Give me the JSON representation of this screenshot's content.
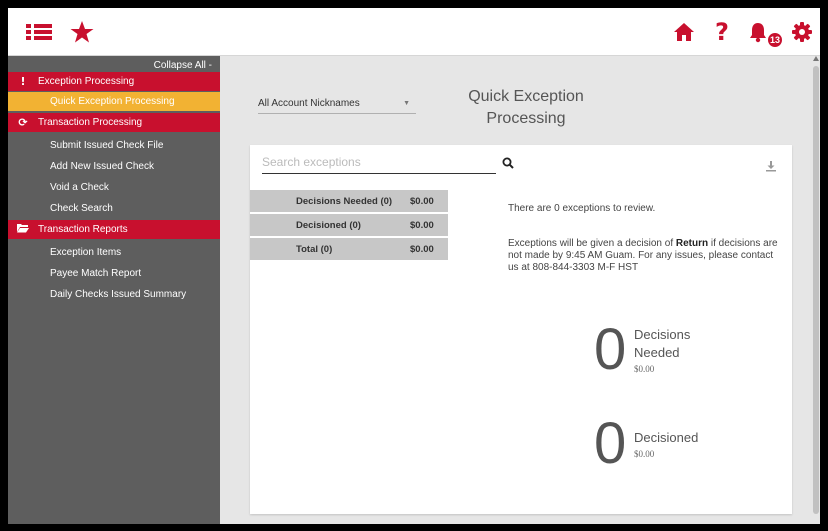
{
  "header": {
    "menu_icon": "list-icon",
    "favorite_icon": "star-icon",
    "home_icon": "home-icon",
    "help_icon": "question-icon",
    "help_glyph": "?",
    "notifications_icon": "bell-icon",
    "notifications_count": "13",
    "settings_icon": "gear-icon",
    "accent_color": "#c8102e"
  },
  "sidebar": {
    "collapse_all": "Collapse All -",
    "sections": [
      {
        "label": "Exception Processing",
        "icon": "exclamation-icon",
        "glyph": "!",
        "items": [
          {
            "label": "Quick Exception Processing",
            "active": true
          }
        ]
      },
      {
        "label": "Transaction Processing",
        "icon": "refresh-icon",
        "glyph": "⟳",
        "items": [
          {
            "label": "Submit Issued Check File"
          },
          {
            "label": "Add New Issued Check"
          },
          {
            "label": "Void a Check"
          },
          {
            "label": "Check Search"
          }
        ]
      },
      {
        "label": "Transaction Reports",
        "icon": "folder-open-icon",
        "glyph": "▬",
        "items": [
          {
            "label": "Exception Items"
          },
          {
            "label": "Payee Match Report"
          },
          {
            "label": "Daily Checks Issued Summary"
          }
        ]
      }
    ],
    "active_color": "#f2b233"
  },
  "main": {
    "account_select": "All Account Nicknames",
    "title": "Quick Exception Processing",
    "search": {
      "placeholder": "Search exceptions",
      "value": ""
    },
    "stats": [
      {
        "label": "Decisions Needed (0)",
        "value": "$0.00"
      },
      {
        "label": "Decisioned (0)",
        "value": "$0.00"
      },
      {
        "label": "Total (0)",
        "value": "$0.00"
      }
    ],
    "message_count": "There are 0 exceptions to review.",
    "message_rule_before": "Exceptions will be given a decision of ",
    "message_rule_bold": "Return",
    "message_rule_after": " if decisions are not made by 9:45 AM Guam. For any issues, please contact us at 808-844-3303 M-F HST",
    "summary": [
      {
        "count": "0",
        "label_line1": "Decisions",
        "label_line2": "Needed",
        "amount": "$0.00"
      },
      {
        "count": "0",
        "label_line1": "Decisioned",
        "label_line2": "",
        "amount": "$0.00"
      }
    ]
  }
}
